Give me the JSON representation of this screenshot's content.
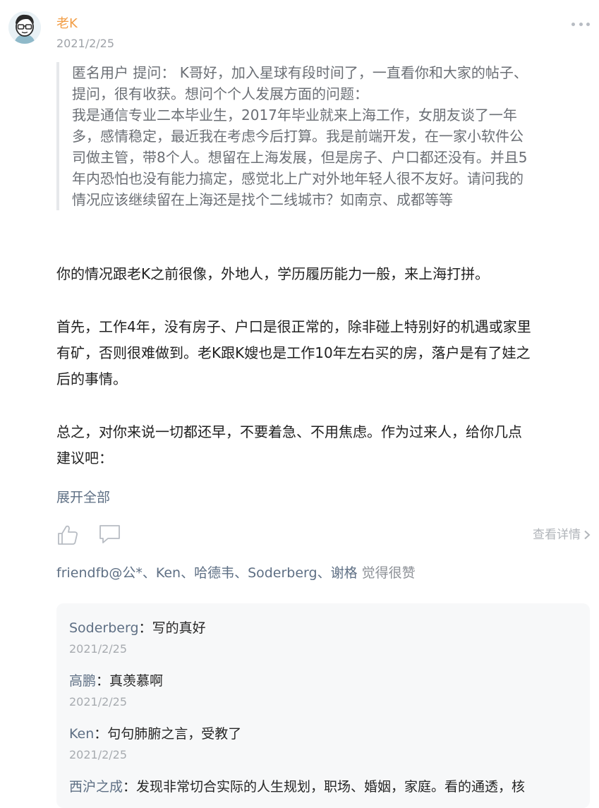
{
  "post": {
    "author": "老K",
    "date": "2021/2/25"
  },
  "question": {
    "line1": "匿名用户  提问：  K哥好，加入星球有段时间了，一直看你和大家的帖子、",
    "line2": "提问，很有收获。想问个个人发展方面的问题：",
    "line3": "我是通信专业二本毕业生，2017年毕业就来上海工作，女朋友谈了一年",
    "line4": "多，感情稳定，最近我在考虑今后打算。我是前端开发，在一家小软件公",
    "line5": "司做主管，带8个人。想留在上海发展，但是房子、户口都还没有。并且5",
    "line6": "年内恐怕也没有能力搞定，感觉北上广对外地年轻人很不友好。请问我的",
    "line7": "情况应该继续留在上海还是找个二线城市？如南京、成都等等"
  },
  "answer": {
    "p1": "你的情况跟老K之前很像，外地人，学历履历能力一般，来上海打拼。",
    "p2_line1": "首先，工作4年，没有房子、户口是很正常的，除非碰上特别好的机遇或家里",
    "p2_line2": "有矿，否则很难做到。老K跟K嫂也是工作10年左右买的房，落户是有了娃之",
    "p2_line3": "后的事情。",
    "p3_line1": "总之，对你来说一切都还早，不要着急、不用焦虑。作为过来人，给你几点",
    "p3_line2": "建议吧："
  },
  "actions": {
    "expand_label": "展开全部",
    "detail_label": "查看详情",
    "like_icon": "thumbs-up-icon",
    "comment_icon": "comment-bubble-icon"
  },
  "likes": {
    "names": "friendfb@公*、Ken、哈德韦、Soderberg、谢格",
    "suffix": " 觉得很赞"
  },
  "comments": [
    {
      "author": "Soderberg",
      "text": "写的真好",
      "date": "2021/2/25"
    },
    {
      "author": "高鹏",
      "text": "真羡慕啊",
      "date": "2021/2/25"
    },
    {
      "author": "Ken",
      "text": "句句肺腑之言，受教了",
      "date": "2021/2/25"
    },
    {
      "author": "西沪之成",
      "text": "发现非常切合实际的人生规划，职场、婚姻，家庭。看的通透，核",
      "date": ""
    }
  ],
  "colors": {
    "author_orange": "#f29d45",
    "link_blue_gray": "#5e6f84",
    "quote_bar": "#e6e8eb",
    "comment_bg": "#f7f8f9"
  }
}
